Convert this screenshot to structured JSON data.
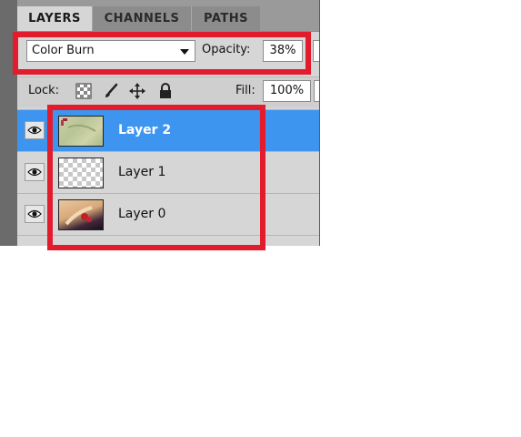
{
  "tabs": [
    {
      "label": "LAYERS",
      "active": true
    },
    {
      "label": "CHANNELS",
      "active": false
    },
    {
      "label": "PATHS",
      "active": false
    }
  ],
  "blend": {
    "mode": "Color Burn",
    "opacity_label": "Opacity:",
    "opacity_value": "38%"
  },
  "lock": {
    "label": "Lock:",
    "icons": [
      "lock-transparent-pixels-icon",
      "lock-image-pixels-icon",
      "lock-position-icon",
      "lock-all-icon"
    ],
    "fill_label": "Fill:",
    "fill_value": "100%"
  },
  "layers": [
    {
      "name": "Layer 2",
      "selected": true,
      "visible": true
    },
    {
      "name": "Layer 1",
      "selected": false,
      "visible": true
    },
    {
      "name": "Layer 0",
      "selected": false,
      "visible": true
    }
  ],
  "colors": {
    "selection": "#3d95f0",
    "highlight": "#e21b2d",
    "panel": "#d6d6d6"
  }
}
